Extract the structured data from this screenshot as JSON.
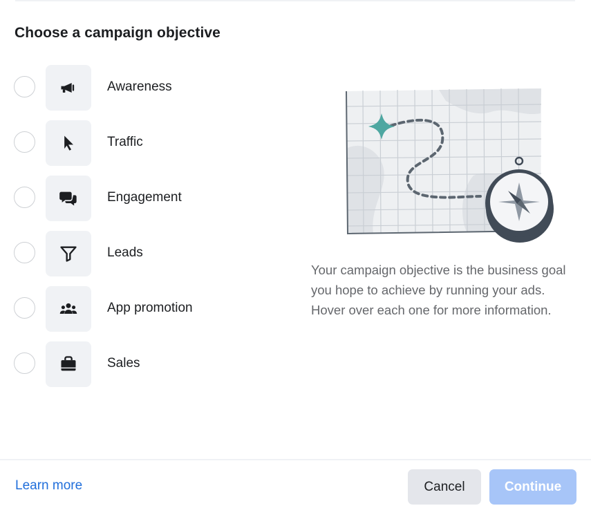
{
  "dialog": {
    "title": "Choose a campaign objective",
    "help_text": "Your campaign objective is the business goal you hope to achieve by running your ads. Hover over each one for more information."
  },
  "objectives": [
    {
      "label": "Awareness",
      "icon": "megaphone-icon",
      "selected": false
    },
    {
      "label": "Traffic",
      "icon": "cursor-icon",
      "selected": false
    },
    {
      "label": "Engagement",
      "icon": "chat-bubbles-icon",
      "selected": false
    },
    {
      "label": "Leads",
      "icon": "funnel-icon",
      "selected": false
    },
    {
      "label": "App promotion",
      "icon": "people-icon",
      "selected": false
    },
    {
      "label": "Sales",
      "icon": "shopping-bag-icon",
      "selected": false
    }
  ],
  "footer": {
    "learn_more": "Learn more",
    "cancel": "Cancel",
    "continue": "Continue",
    "continue_enabled": false
  },
  "colors": {
    "link": "#216fdb",
    "continue_disabled_bg": "#a7c5f8",
    "tile_bg": "#f0f2f5",
    "sparkle": "#4ea7a1",
    "compass_dark": "#414b57"
  }
}
